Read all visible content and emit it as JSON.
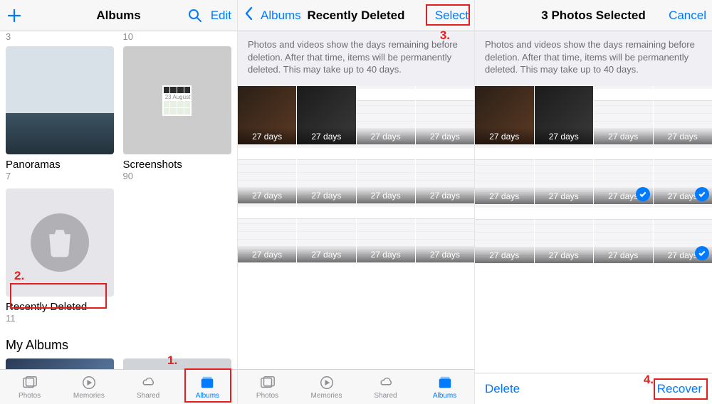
{
  "panel1": {
    "nav": {
      "title": "Albums",
      "edit": "Edit"
    },
    "top_counts": [
      "3",
      "10"
    ],
    "albums": [
      {
        "name": "Panoramas",
        "count": "7"
      },
      {
        "name": "Screenshots",
        "count": "90",
        "date": "23 August"
      },
      {
        "name": "Recently Deleted",
        "count": "11"
      }
    ],
    "section": "My Albums"
  },
  "tabs": {
    "photos": "Photos",
    "memories": "Memories",
    "shared": "Shared",
    "albums": "Albums"
  },
  "panel2": {
    "nav": {
      "back": "Albums",
      "title": "Recently Deleted",
      "select": "Select"
    },
    "info": "Photos and videos show the days remaining before deletion. After that time, items will be permanently deleted. This may take up to 40 days.",
    "cells": [
      "27 days",
      "27 days",
      "27 days",
      "27 days",
      "27 days",
      "27 days",
      "27 days",
      "27 days",
      "27 days",
      "27 days",
      "27 days",
      "27 days"
    ]
  },
  "panel3": {
    "nav": {
      "title": "3 Photos Selected",
      "cancel": "Cancel"
    },
    "info": "Photos and videos show the days remaining before deletion. After that time, items will be permanently deleted. This may take up to 40 days.",
    "cells": [
      {
        "label": "27 days"
      },
      {
        "label": "27 days"
      },
      {
        "label": "27 days"
      },
      {
        "label": "27 days"
      },
      {
        "label": "27 days"
      },
      {
        "label": "27 days"
      },
      {
        "label": "27 days",
        "selected": true
      },
      {
        "label": "27 days",
        "selected": true
      },
      {
        "label": "27 days"
      },
      {
        "label": "27 days"
      },
      {
        "label": "27 days"
      },
      {
        "label": "27 days",
        "selected": true
      }
    ],
    "toolbar": {
      "delete": "Delete",
      "recover": "Recover"
    }
  },
  "callouts": {
    "n1": "1.",
    "n2": "2.",
    "n3": "3.",
    "n4": "4."
  }
}
